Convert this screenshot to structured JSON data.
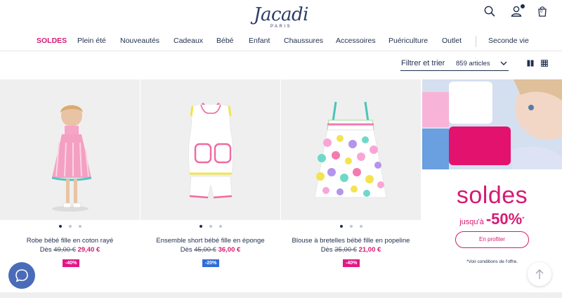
{
  "header": {
    "logo": "Jacadi",
    "logo_sub": "PARIS",
    "icons": [
      "search-icon",
      "account-icon",
      "bag-icon"
    ],
    "bag_count": "0"
  },
  "nav": {
    "items": [
      "SOLDES",
      "Plein été",
      "Nouveautés",
      "Cadeaux",
      "Bébé",
      "Enfant",
      "Chaussures",
      "Accessoires",
      "Puériculture",
      "Outlet",
      "Seconde vie"
    ]
  },
  "toolbar": {
    "filter_label": "Filtrer et trier",
    "count": "859 articles"
  },
  "products": [
    {
      "name": "Robe bébé fille en coton rayé",
      "from": "Dès",
      "old_price": "49,00 €",
      "new_price": "29,40 €",
      "badge": "-40%",
      "badge_color": "#e21883"
    },
    {
      "name": "Ensemble short bébé fille en éponge",
      "from": "Dès",
      "old_price": "45,00 €",
      "new_price": "36,00 €",
      "badge": "-20%",
      "badge_color": "#2f6fd6"
    },
    {
      "name": "Blouse à bretelles bébé fille en popeline",
      "from": "Dès",
      "old_price": "35,00 €",
      "new_price": "21,00 €",
      "badge": "-40%",
      "badge_color": "#e21883"
    }
  ],
  "promo": {
    "title": "soldes",
    "subtitle_prefix": "jusqu'à",
    "subtitle_value": "-50%",
    "subtitle_star": "*",
    "button": "En profiter",
    "note": "*Voir conditions de l'offre."
  },
  "colors": {
    "brand_pink": "#d61a72",
    "navy": "#1f2d4d",
    "chat_blue": "#4a6bb8"
  }
}
